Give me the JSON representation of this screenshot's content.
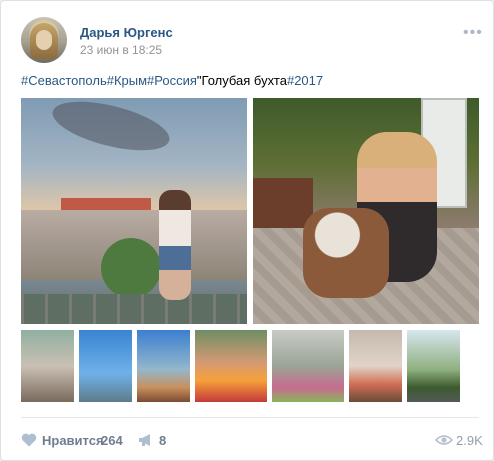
{
  "post": {
    "author": "Дарья Юргенс",
    "date": "23 июн в 18:25",
    "more": "•••",
    "hashtags": [
      "#Севастополь",
      "#Крым",
      "#Россия"
    ],
    "text": "\"Голубая бухта",
    "tag_year": "#2017"
  },
  "footer": {
    "like_label": "Нравится",
    "like_count": "264",
    "share_count": "8",
    "views": "2.9K"
  },
  "colors": {
    "link": "#2a5885",
    "muted": "#939393",
    "action": "#6f7d8f"
  }
}
